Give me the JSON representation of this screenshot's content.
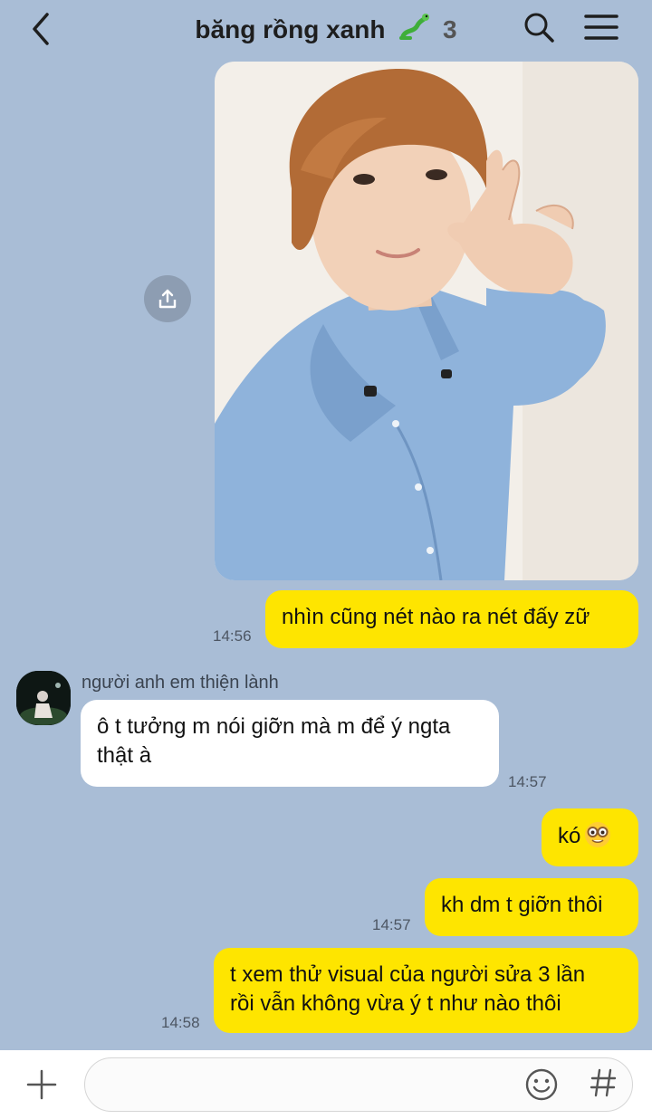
{
  "header": {
    "title": "băng rồng xanh",
    "member_count": "3"
  },
  "messages": {
    "m1_text": "nhìn cũng nét nào ra nét đấy zữ",
    "m1_time": "14:56",
    "sender_name": "người anh em thiện lành",
    "m2_line1": "ô t tưởng m nói giỡn mà m để ý ngta",
    "m2_line2": "thật à",
    "m2_time": "14:57",
    "m3_text": "kó",
    "m4_text": "kh dm t giỡn thôi",
    "m4_time": "14:57",
    "m5_line1": "t xem thử visual của người sửa 3 lần",
    "m5_line2": "rồi vẫn không vừa ý t như nào thôi",
    "m5_time": "14:58"
  },
  "input": {
    "value": "",
    "placeholder": ""
  },
  "icons": {
    "back": "back-arrow-icon",
    "dragon": "dragon-emoji-icon",
    "search": "search-icon",
    "menu": "hamburger-menu-icon",
    "share": "share-icon",
    "nerd_emoji": "nerd-face-emoji-icon",
    "plus": "plus-icon",
    "emoji": "smiley-icon",
    "hash": "hashtag-icon"
  },
  "colors": {
    "background": "#a9bdd6",
    "my_bubble": "#fee500",
    "their_bubble": "#ffffff"
  }
}
